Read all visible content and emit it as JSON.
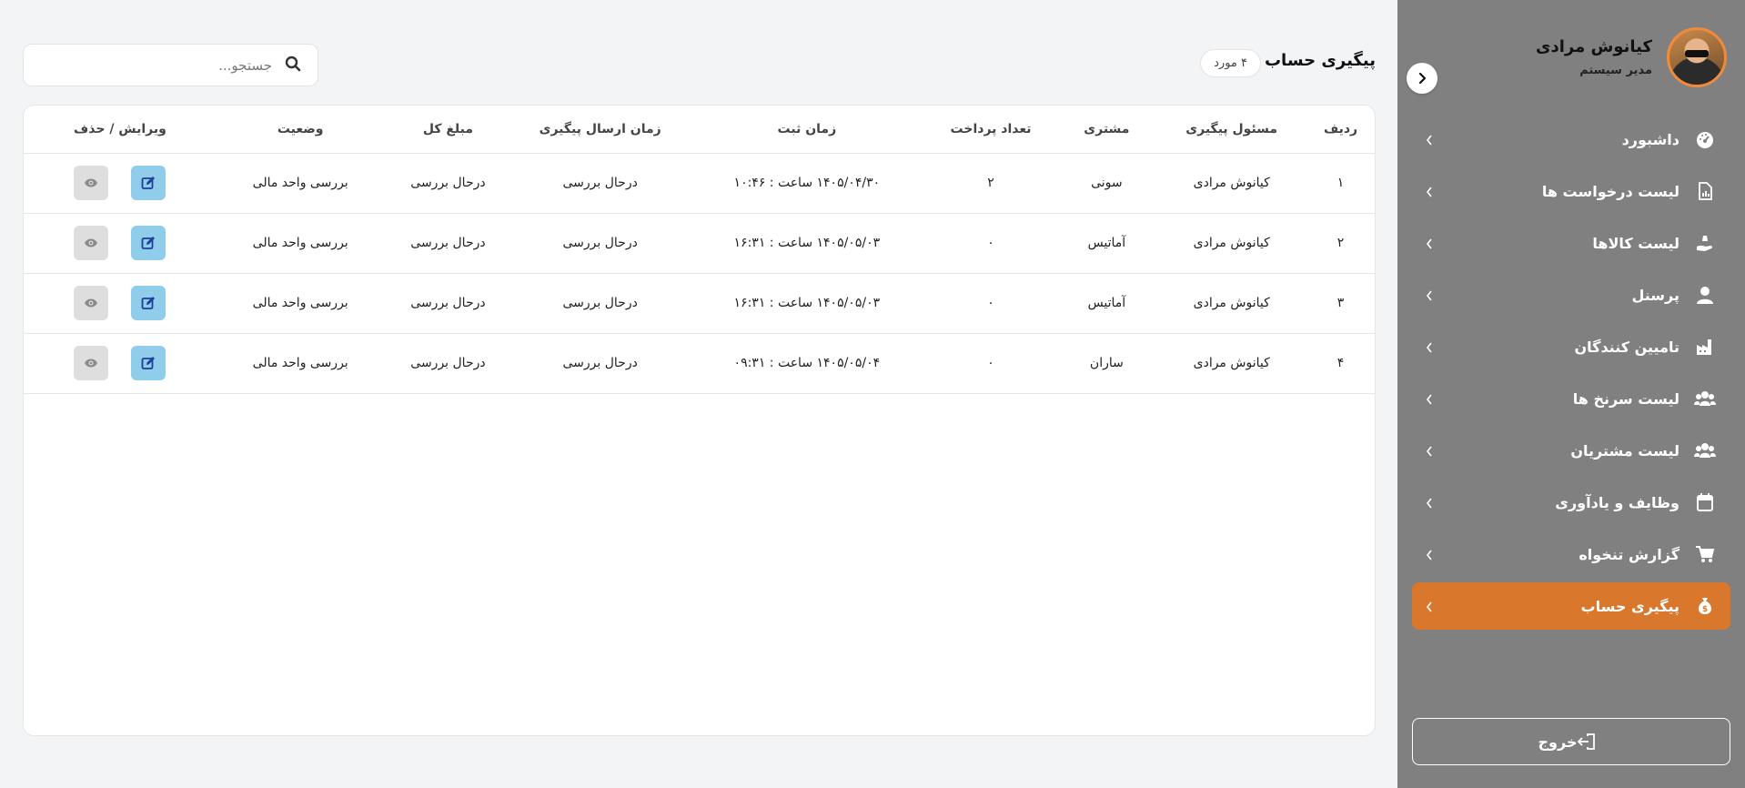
{
  "user": {
    "name": "کیانوش مرادی",
    "role": "مدیر سیستم"
  },
  "menu": [
    {
      "label": "داشبورد",
      "icon": "dashboard-icon"
    },
    {
      "label": "لیست درخواست ها",
      "icon": "document-chart-icon"
    },
    {
      "label": "لیست کالاها",
      "icon": "hand-holding-icon"
    },
    {
      "label": "پرسنل",
      "icon": "user-icon"
    },
    {
      "label": "تامیین کنندگان",
      "icon": "factory-icon"
    },
    {
      "label": "لیست سرنخ ها",
      "icon": "users-icon"
    },
    {
      "label": "لیست مشتریان",
      "icon": "users-icon"
    },
    {
      "label": "وظایف و یادآوری",
      "icon": "calendar-icon"
    },
    {
      "label": "گزارش تنخواه",
      "icon": "cart-icon"
    },
    {
      "label": "پیگیری حساب",
      "icon": "money-bag-icon",
      "active": true
    }
  ],
  "logout_label": "خروج",
  "page": {
    "title": "پیگیری حساب",
    "count_badge": "۴ مورد"
  },
  "search": {
    "placeholder": "جستجو..."
  },
  "table": {
    "headers": [
      "ردیف",
      "مسئول پیگیری",
      "مشتری",
      "تعداد پرداخت",
      "زمان ثبت",
      "زمان ارسال پیگیری",
      "مبلغ کل",
      "وضعیت",
      "ویرایش / حذف"
    ],
    "rows": [
      {
        "row": "۱",
        "owner": "کیانوش مرادی",
        "customer": "سونی",
        "payments": "۲",
        "registered": "۱۴۰۵/۰۴/۳۰ ساعت : ۱۰:۴۶",
        "sent": "درحال بررسی",
        "amount": "درحال بررسی",
        "status": "بررسی واحد مالی"
      },
      {
        "row": "۲",
        "owner": "کیانوش مرادی",
        "customer": "آماتیس",
        "payments": "۰",
        "registered": "۱۴۰۵/۰۵/۰۳ ساعت : ۱۶:۳۱",
        "sent": "درحال بررسی",
        "amount": "درحال بررسی",
        "status": "بررسی واحد مالی"
      },
      {
        "row": "۳",
        "owner": "کیانوش مرادی",
        "customer": "آماتیس",
        "payments": "۰",
        "registered": "۱۴۰۵/۰۵/۰۳ ساعت : ۱۶:۳۱",
        "sent": "درحال بررسی",
        "amount": "درحال بررسی",
        "status": "بررسی واحد مالی"
      },
      {
        "row": "۴",
        "owner": "کیانوش مرادی",
        "customer": "ساران",
        "payments": "۰",
        "registered": "۱۴۰۵/۰۵/۰۴ ساعت : ۰۹:۳۱",
        "sent": "درحال بررسی",
        "amount": "درحال بررسی",
        "status": "بررسی واحد مالی"
      }
    ]
  },
  "colors": {
    "sidebar": "#808080",
    "active": "#d9782d",
    "edit_button": "#8fcdeb",
    "view_button": "#dedede"
  }
}
